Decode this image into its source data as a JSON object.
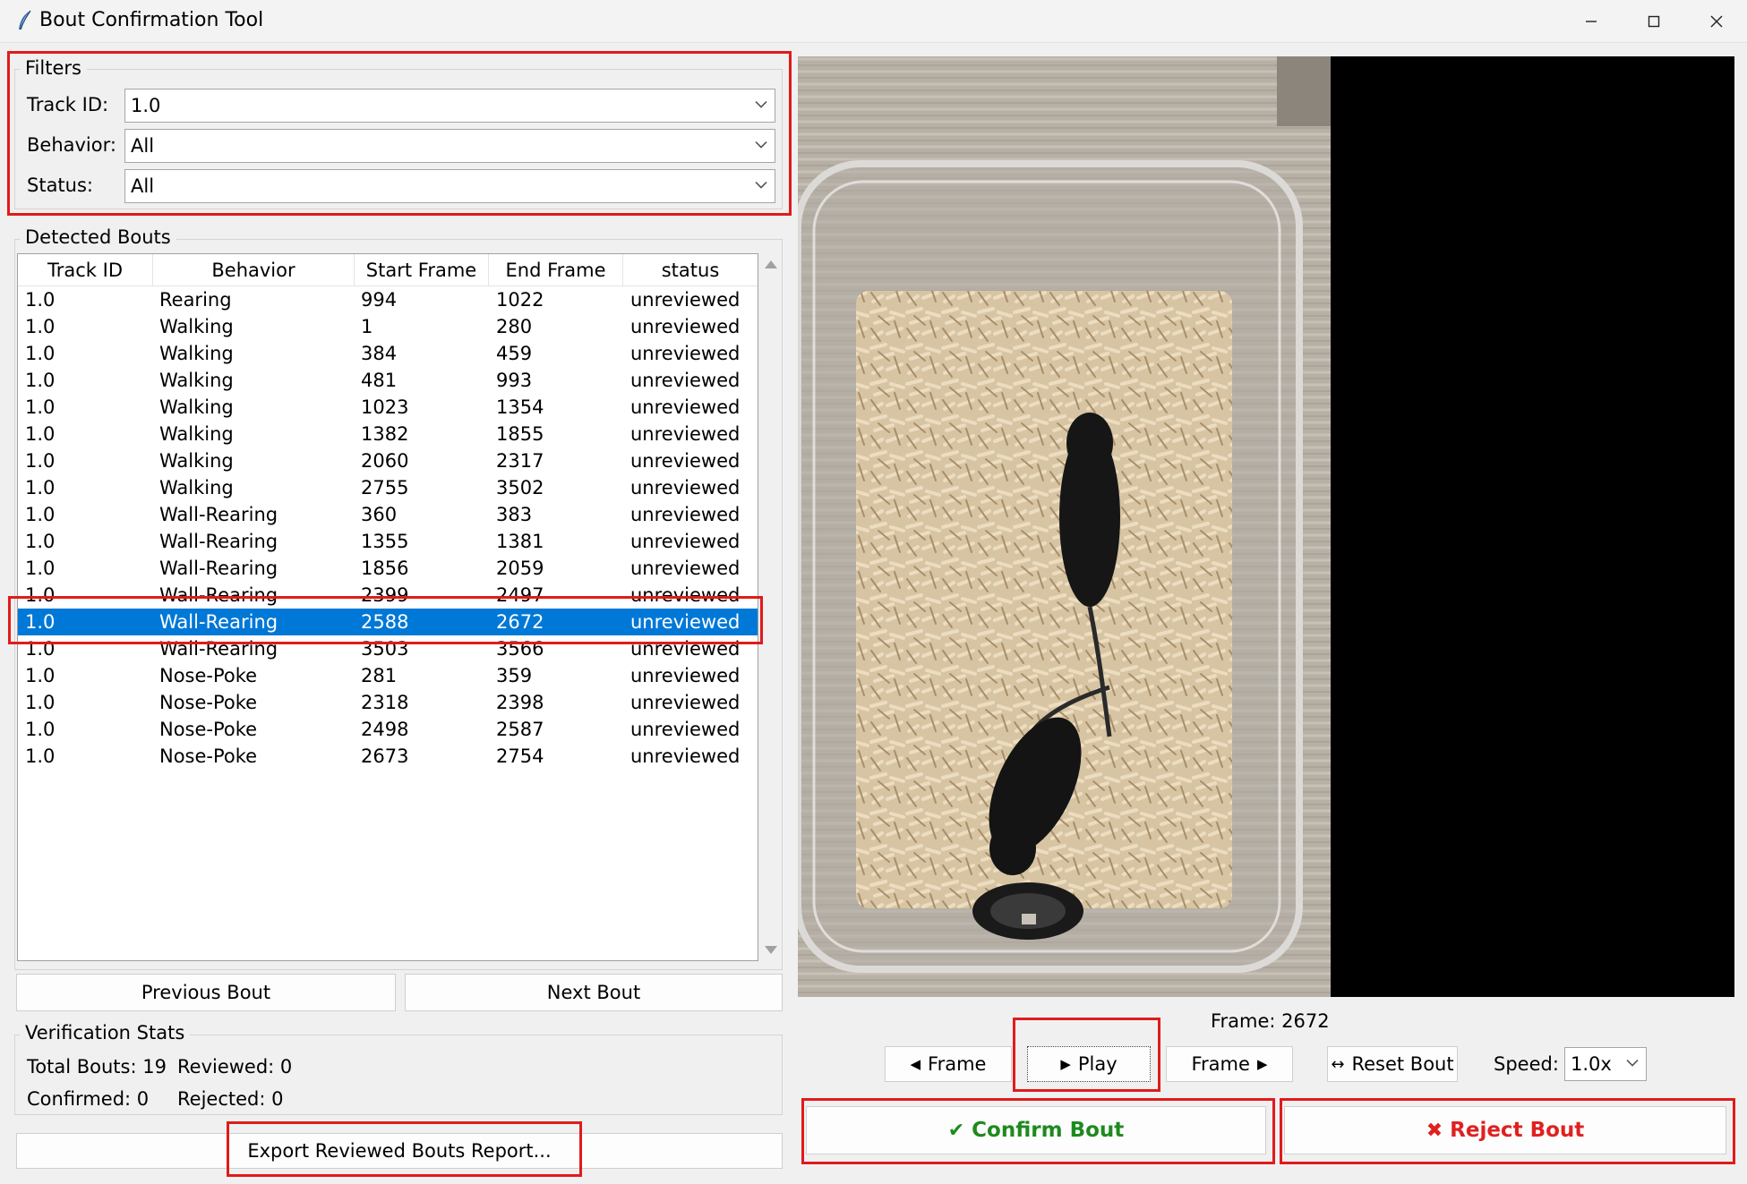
{
  "window": {
    "title": "Bout Confirmation Tool",
    "minimize_glyph": "—",
    "maximize_glyph": "☐",
    "close_glyph": "✕"
  },
  "filters": {
    "group_label": "Filters",
    "track_id": {
      "label": "Track ID:",
      "value": "1.0"
    },
    "behavior": {
      "label": "Behavior:",
      "value": "All"
    },
    "status": {
      "label": "Status:",
      "value": "All"
    }
  },
  "detected_bouts": {
    "group_label": "Detected Bouts",
    "columns": [
      "Track ID",
      "Behavior",
      "Start Frame",
      "End Frame",
      "status"
    ],
    "rows": [
      [
        "1.0",
        "Rearing",
        "994",
        "1022",
        "unreviewed"
      ],
      [
        "1.0",
        "Walking",
        "1",
        "280",
        "unreviewed"
      ],
      [
        "1.0",
        "Walking",
        "384",
        "459",
        "unreviewed"
      ],
      [
        "1.0",
        "Walking",
        "481",
        "993",
        "unreviewed"
      ],
      [
        "1.0",
        "Walking",
        "1023",
        "1354",
        "unreviewed"
      ],
      [
        "1.0",
        "Walking",
        "1382",
        "1855",
        "unreviewed"
      ],
      [
        "1.0",
        "Walking",
        "2060",
        "2317",
        "unreviewed"
      ],
      [
        "1.0",
        "Walking",
        "2755",
        "3502",
        "unreviewed"
      ],
      [
        "1.0",
        "Wall-Rearing",
        "360",
        "383",
        "unreviewed"
      ],
      [
        "1.0",
        "Wall-Rearing",
        "1355",
        "1381",
        "unreviewed"
      ],
      [
        "1.0",
        "Wall-Rearing",
        "1856",
        "2059",
        "unreviewed"
      ],
      [
        "1.0",
        "Wall-Rearing",
        "2399",
        "2497",
        "unreviewed"
      ],
      [
        "1.0",
        "Wall-Rearing",
        "2588",
        "2672",
        "unreviewed"
      ],
      [
        "1.0",
        "Wall-Rearing",
        "3503",
        "3566",
        "unreviewed"
      ],
      [
        "1.0",
        "Nose-Poke",
        "281",
        "359",
        "unreviewed"
      ],
      [
        "1.0",
        "Nose-Poke",
        "2318",
        "2398",
        "unreviewed"
      ],
      [
        "1.0",
        "Nose-Poke",
        "2498",
        "2587",
        "unreviewed"
      ],
      [
        "1.0",
        "Nose-Poke",
        "2673",
        "2754",
        "unreviewed"
      ]
    ],
    "selected_row_index": 12
  },
  "navigation": {
    "previous_label": "Previous Bout",
    "next_label": "Next Bout"
  },
  "stats": {
    "group_label": "Verification Stats",
    "total_bouts": "Total Bouts: 19",
    "reviewed": "Reviewed: 0",
    "confirmed": "Confirmed: 0",
    "rejected": "Rejected: 0"
  },
  "export": {
    "label": "Export Reviewed Bouts Report..."
  },
  "player": {
    "frame_text": "Frame: 2672",
    "prev_frame_label": "Frame",
    "play_label": "Play",
    "next_frame_label": "Frame",
    "reset_label": "Reset Bout",
    "speed_label": "Speed:",
    "speed_value": "1.0x",
    "icons": {
      "prev": "◀",
      "play": "▶",
      "next": "▶",
      "reset": "↔",
      "dropdown": "chevron-down-icon"
    }
  },
  "decision": {
    "confirm_label": "Confirm Bout",
    "confirm_glyph": "✔",
    "confirm_color": "#1e8a1e",
    "reject_label": "Reject Bout",
    "reject_glyph": "✖",
    "reject_color": "#e02020"
  },
  "colors": {
    "highlight_box": "#e01b1b",
    "selection": "#0078d7"
  }
}
